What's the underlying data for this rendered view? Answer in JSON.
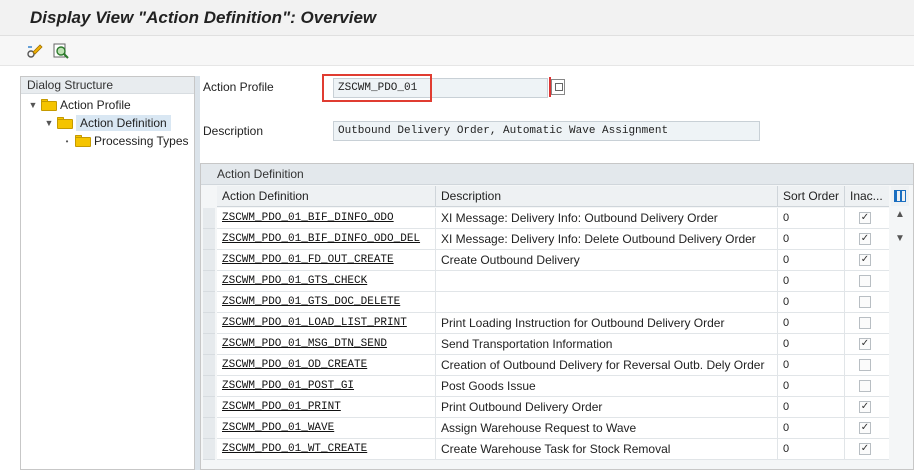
{
  "window": {
    "title": "Display View \"Action Definition\": Overview"
  },
  "toolbar": {
    "buttons": [
      {
        "icon": "display-change-icon"
      },
      {
        "icon": "find-icon"
      }
    ]
  },
  "dialog_structure": {
    "header": "Dialog Structure",
    "items": [
      {
        "label": "Action Profile",
        "level": 0,
        "expanded": true
      },
      {
        "label": "Action Definition",
        "level": 1,
        "expanded": true,
        "selected": true
      },
      {
        "label": "Processing Types",
        "level": 2,
        "expanded": false
      }
    ]
  },
  "header_fields": {
    "action_profile_label": "Action Profile",
    "action_profile_value": "ZSCWM_PDO_01",
    "description_label": "Description",
    "description_value": "Outbound Delivery Order, Automatic Wave Assignment"
  },
  "table": {
    "title": "Action Definition",
    "columns": [
      "Action Definition",
      "Description",
      "Sort Order",
      "Inac..."
    ],
    "rows": [
      {
        "action": "ZSCWM_PDO_01_BIF_DINFO_ODO",
        "description": "XI Message: Delivery Info: Outbound Delivery Order",
        "sort": "0",
        "inactive": true
      },
      {
        "action": "ZSCWM_PDO_01_BIF_DINFO_ODO_DEL",
        "description": "XI Message: Delivery Info: Delete Outbound Delivery Order",
        "sort": "0",
        "inactive": true
      },
      {
        "action": "ZSCWM_PDO_01_FD_OUT_CREATE",
        "description": "Create Outbound Delivery",
        "sort": "0",
        "inactive": true
      },
      {
        "action": "ZSCWM_PDO_01_GTS_CHECK",
        "description": "",
        "sort": "0",
        "inactive": false
      },
      {
        "action": "ZSCWM_PDO_01_GTS_DOC_DELETE",
        "description": "",
        "sort": "0",
        "inactive": false
      },
      {
        "action": "ZSCWM_PDO_01_LOAD_LIST_PRINT",
        "description": "Print Loading Instruction for Outbound Delivery Order",
        "sort": "0",
        "inactive": false
      },
      {
        "action": "ZSCWM_PDO_01_MSG_DTN_SEND",
        "description": "Send Transportation Information",
        "sort": "0",
        "inactive": true
      },
      {
        "action": "ZSCWM_PDO_01_OD_CREATE",
        "description": "Creation of Outbound Delivery for Reversal Outb. Dely Order",
        "sort": "0",
        "inactive": false
      },
      {
        "action": "ZSCWM_PDO_01_POST_GI",
        "description": "Post Goods Issue",
        "sort": "0",
        "inactive": false
      },
      {
        "action": "ZSCWM_PDO_01_PRINT",
        "description": "Print Outbound Delivery Order",
        "sort": "0",
        "inactive": true
      },
      {
        "action": "ZSCWM_PDO_01_WAVE",
        "description": "Assign Warehouse Request to Wave",
        "sort": "0",
        "inactive": true
      },
      {
        "action": "ZSCWM_PDO_01_WT_CREATE",
        "description": "Create Warehouse Task for Stock Removal",
        "sort": "0",
        "inactive": true
      }
    ],
    "check_mark": "✓",
    "scroll_up": "▲",
    "scroll_down": "▼"
  }
}
